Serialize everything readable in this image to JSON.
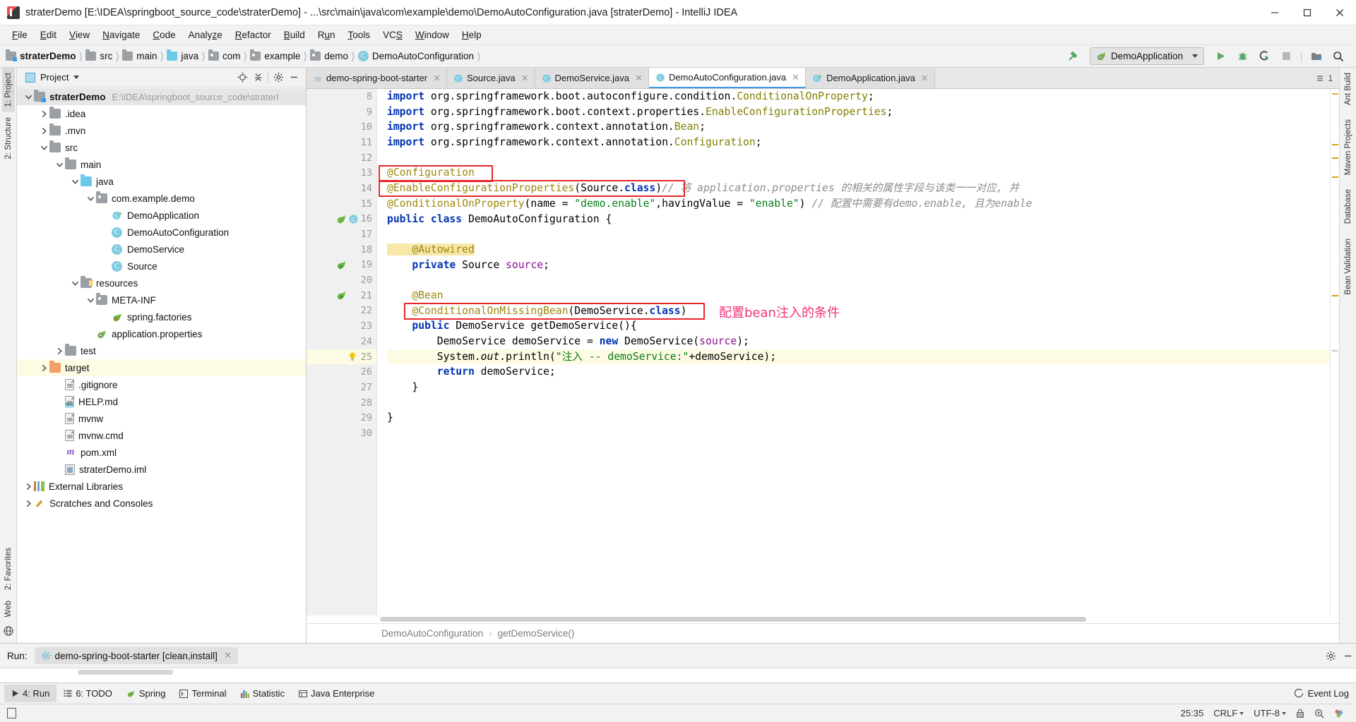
{
  "window": {
    "title": "straterDemo [E:\\IDEA\\springboot_source_code\\straterDemo] - ...\\src\\main\\java\\com\\example\\demo\\DemoAutoConfiguration.java [straterDemo] - IntelliJ IDEA",
    "minimize": "─",
    "maximize": "❐",
    "close": "✕"
  },
  "menu": [
    "File",
    "Edit",
    "View",
    "Navigate",
    "Code",
    "Analyze",
    "Refactor",
    "Build",
    "Run",
    "Tools",
    "VCS",
    "Window",
    "Help"
  ],
  "breadcrumb": [
    {
      "label": "straterDemo",
      "icon": "project-folder-icon",
      "bold": true
    },
    {
      "label": "src",
      "icon": "folder-icon",
      "bold": false
    },
    {
      "label": "main",
      "icon": "folder-icon",
      "bold": false
    },
    {
      "label": "java",
      "icon": "source-folder-icon",
      "bold": false
    },
    {
      "label": "com",
      "icon": "package-icon",
      "bold": false
    },
    {
      "label": "example",
      "icon": "package-icon",
      "bold": false
    },
    {
      "label": "demo",
      "icon": "package-icon",
      "bold": false
    },
    {
      "label": "DemoAutoConfiguration",
      "icon": "class-icon",
      "bold": false
    }
  ],
  "toolbar": {
    "build_icon": "hammer-icon",
    "run_config": "DemoApplication",
    "run_icon": "run-icon",
    "debug_icon": "debug-icon",
    "coverage_icon": "run-with-coverage-icon",
    "stop_icon": "stop-icon",
    "project_structure_icon": "project-structure-icon",
    "search_icon": "search-icon"
  },
  "project_panel": {
    "title": "Project",
    "locate_icon": "locate-icon",
    "collapse_icon": "collapse-all-icon",
    "settings_icon": "gear-icon",
    "hide_icon": "hide-icon",
    "tree": [
      {
        "label": "straterDemo",
        "path": "E:\\IDEA\\springboot_source_code\\straterI",
        "indent": 0,
        "twist": "down",
        "icon": "project-folder-icon",
        "bold": true,
        "state": "sel"
      },
      {
        "label": ".idea",
        "indent": 1,
        "twist": "right",
        "icon": "folder-icon"
      },
      {
        "label": ".mvn",
        "indent": 1,
        "twist": "right",
        "icon": "folder-icon"
      },
      {
        "label": "src",
        "indent": 1,
        "twist": "down",
        "icon": "folder-icon"
      },
      {
        "label": "main",
        "indent": 2,
        "twist": "down",
        "icon": "folder-icon"
      },
      {
        "label": "java",
        "indent": 3,
        "twist": "down",
        "icon": "source-folder-icon"
      },
      {
        "label": "com.example.demo",
        "indent": 4,
        "twist": "down",
        "icon": "package-icon"
      },
      {
        "label": "DemoApplication",
        "indent": 5,
        "twist": "none",
        "icon": "spring-class-icon"
      },
      {
        "label": "DemoAutoConfiguration",
        "indent": 5,
        "twist": "none",
        "icon": "class-icon"
      },
      {
        "label": "DemoService",
        "indent": 5,
        "twist": "none",
        "icon": "class-icon"
      },
      {
        "label": "Source",
        "indent": 5,
        "twist": "none",
        "icon": "class-icon"
      },
      {
        "label": "resources",
        "indent": 3,
        "twist": "down",
        "icon": "resources-folder-icon"
      },
      {
        "label": "META-INF",
        "indent": 4,
        "twist": "down",
        "icon": "package-icon"
      },
      {
        "label": "spring.factories",
        "indent": 5,
        "twist": "none",
        "icon": "spring-factories-icon"
      },
      {
        "label": "application.properties",
        "indent": 4,
        "twist": "none",
        "icon": "spring-properties-icon"
      },
      {
        "label": "test",
        "indent": 2,
        "twist": "right",
        "icon": "folder-icon"
      },
      {
        "label": "target",
        "indent": 1,
        "twist": "right",
        "icon": "target-folder-icon",
        "state": "hl"
      },
      {
        "label": ".gitignore",
        "indent": 2,
        "twist": "none",
        "icon": "file-icon"
      },
      {
        "label": "HELP.md",
        "indent": 2,
        "twist": "none",
        "icon": "markdown-icon"
      },
      {
        "label": "mvnw",
        "indent": 2,
        "twist": "none",
        "icon": "file-icon"
      },
      {
        "label": "mvnw.cmd",
        "indent": 2,
        "twist": "none",
        "icon": "file-icon"
      },
      {
        "label": "pom.xml",
        "indent": 2,
        "twist": "none",
        "icon": "maven-icon"
      },
      {
        "label": "straterDemo.iml",
        "indent": 2,
        "twist": "none",
        "icon": "iml-icon"
      },
      {
        "label": "External Libraries",
        "indent": 0,
        "twist": "right",
        "icon": "libraries-icon"
      },
      {
        "label": "Scratches and Consoles",
        "indent": 0,
        "twist": "right",
        "icon": "scratches-icon"
      }
    ]
  },
  "left_strip": [
    "1: Project",
    "2: Structure",
    "2: Favorites",
    "Web"
  ],
  "right_strip": [
    "Ant Build",
    "Maven Projects",
    "Database",
    "Bean Validation"
  ],
  "editor_tabs": [
    {
      "label": "demo-spring-boot-starter",
      "icon": "maven-module-icon",
      "active": false
    },
    {
      "label": "Source.java",
      "icon": "class-icon",
      "active": false
    },
    {
      "label": "DemoService.java",
      "icon": "class-icon",
      "active": false
    },
    {
      "label": "DemoAutoConfiguration.java",
      "icon": "class-icon",
      "active": true
    },
    {
      "label": "DemoApplication.java",
      "icon": "spring-class-icon",
      "active": false
    }
  ],
  "editor_tabs_overflow": "1",
  "code": {
    "first_line": 8,
    "lines": [
      {
        "n": 8,
        "tokens": [
          {
            "t": "import ",
            "c": "kw"
          },
          {
            "t": "org.springframework.boot.autoconfigure.condition.",
            "c": "id"
          },
          {
            "t": "ConditionalOnProperty",
            "c": "ann2"
          },
          {
            "t": ";",
            "c": "id"
          }
        ]
      },
      {
        "n": 9,
        "tokens": [
          {
            "t": "import ",
            "c": "kw"
          },
          {
            "t": "org.springframework.boot.context.properties.",
            "c": "id"
          },
          {
            "t": "EnableConfigurationProperties",
            "c": "ann2"
          },
          {
            "t": ";",
            "c": "id"
          }
        ]
      },
      {
        "n": 10,
        "tokens": [
          {
            "t": "import ",
            "c": "kw"
          },
          {
            "t": "org.springframework.context.annotation.",
            "c": "id"
          },
          {
            "t": "Bean",
            "c": "ann2"
          },
          {
            "t": ";",
            "c": "id"
          }
        ]
      },
      {
        "n": 11,
        "tokens": [
          {
            "t": "import ",
            "c": "kw"
          },
          {
            "t": "org.springframework.context.annotation.",
            "c": "id"
          },
          {
            "t": "Configuration",
            "c": "ann2"
          },
          {
            "t": ";",
            "c": "id"
          }
        ]
      },
      {
        "n": 12,
        "tokens": []
      },
      {
        "n": 13,
        "tokens": [
          {
            "t": "@Configuration",
            "c": "ann"
          }
        ]
      },
      {
        "n": 14,
        "tokens": [
          {
            "t": "@EnableConfigurationProperties",
            "c": "ann"
          },
          {
            "t": "(",
            "c": "id"
          },
          {
            "t": "Source",
            "c": "id"
          },
          {
            "t": ".",
            "c": "id"
          },
          {
            "t": "class",
            "c": "kw"
          },
          {
            "t": ")",
            "c": "id"
          },
          {
            "t": "// 将 application.properties 的相关的属性字段与该类一一对应, 并",
            "c": "cmt"
          }
        ]
      },
      {
        "n": 15,
        "tokens": [
          {
            "t": "@ConditionalOnProperty",
            "c": "ann"
          },
          {
            "t": "(name = ",
            "c": "id"
          },
          {
            "t": "\"demo.enable\"",
            "c": "str"
          },
          {
            "t": ",havingValue = ",
            "c": "id"
          },
          {
            "t": "\"enable\"",
            "c": "str"
          },
          {
            "t": ") ",
            "c": "id"
          },
          {
            "t": "// 配置中需要有demo.enable, 且为enable",
            "c": "cmt"
          }
        ]
      },
      {
        "n": 16,
        "tokens": [
          {
            "t": "public class ",
            "c": "kw"
          },
          {
            "t": "DemoAutoConfiguration",
            "c": "id"
          },
          {
            "t": " {",
            "c": "id"
          }
        ]
      },
      {
        "n": 17,
        "tokens": []
      },
      {
        "n": 18,
        "tokens": [
          {
            "t": "    @Autowired",
            "c": "ann"
          }
        ]
      },
      {
        "n": 19,
        "tokens": [
          {
            "t": "    ",
            "c": "id"
          },
          {
            "t": "private ",
            "c": "kw"
          },
          {
            "t": "Source ",
            "c": "id"
          },
          {
            "t": "source",
            "c": "fld"
          },
          {
            "t": ";",
            "c": "id"
          }
        ]
      },
      {
        "n": 20,
        "tokens": []
      },
      {
        "n": 21,
        "tokens": [
          {
            "t": "    @Bean",
            "c": "ann"
          }
        ]
      },
      {
        "n": 22,
        "tokens": [
          {
            "t": "    @ConditionalOnMissingBean",
            "c": "ann"
          },
          {
            "t": "(",
            "c": "id"
          },
          {
            "t": "DemoService",
            "c": "id"
          },
          {
            "t": ".",
            "c": "id"
          },
          {
            "t": "class",
            "c": "kw"
          },
          {
            "t": ")",
            "c": "id"
          }
        ]
      },
      {
        "n": 23,
        "tokens": [
          {
            "t": "    ",
            "c": "id"
          },
          {
            "t": "public ",
            "c": "kw"
          },
          {
            "t": "DemoService getDemoService(){",
            "c": "id"
          }
        ]
      },
      {
        "n": 24,
        "tokens": [
          {
            "t": "        DemoService demoService = ",
            "c": "id"
          },
          {
            "t": "new ",
            "c": "kw"
          },
          {
            "t": "DemoService(",
            "c": "id"
          },
          {
            "t": "source",
            "c": "fld"
          },
          {
            "t": ");",
            "c": "id"
          }
        ]
      },
      {
        "n": 25,
        "tokens": [
          {
            "t": "        System.",
            "c": "id"
          },
          {
            "t": "out",
            "c": "stat"
          },
          {
            "t": ".println(",
            "c": "id"
          },
          {
            "t": "\"注入 -- demoService:\"",
            "c": "str"
          },
          {
            "t": "+demoService);",
            "c": "id"
          }
        ],
        "highlight": true
      },
      {
        "n": 26,
        "tokens": [
          {
            "t": "        ",
            "c": "id"
          },
          {
            "t": "return ",
            "c": "kw"
          },
          {
            "t": "demoService;",
            "c": "id"
          }
        ]
      },
      {
        "n": 27,
        "tokens": [
          {
            "t": "    }",
            "c": "id"
          }
        ]
      },
      {
        "n": 28,
        "tokens": []
      },
      {
        "n": 29,
        "tokens": [
          {
            "t": "}",
            "c": "id"
          }
        ]
      },
      {
        "n": 30,
        "tokens": []
      }
    ],
    "annotation_note": "配置bean注入的条件",
    "note_color": "#f0327a",
    "redbox_color": "#e8262a"
  },
  "editor_breadcrumb": [
    "DemoAutoConfiguration",
    "getDemoService()"
  ],
  "run_panel": {
    "label": "Run:",
    "tab": "demo-spring-boot-starter [clean,install]",
    "tab_icon": "gear-spinner-icon",
    "close_icon": "✕",
    "settings_icon": "gear-icon",
    "hide_icon": "hide-icon"
  },
  "bottom_tabs": [
    {
      "label": "4: Run",
      "icon": "run-icon",
      "active": true
    },
    {
      "label": "6: TODO",
      "icon": "todo-icon",
      "active": false
    },
    {
      "label": "Spring",
      "icon": "spring-leaf-icon",
      "active": false
    },
    {
      "label": "Terminal",
      "icon": "terminal-icon",
      "active": false
    },
    {
      "label": "Statistic",
      "icon": "statistic-icon",
      "active": false
    },
    {
      "label": "Java Enterprise",
      "icon": "java-enterprise-icon",
      "active": false
    }
  ],
  "event_log": {
    "label": "Event Log",
    "icon": "event-log-icon"
  },
  "status": {
    "caret": "25:35",
    "line_sep": "CRLF",
    "encoding": "UTF-8",
    "lock_icon": "lock-icon",
    "inspect_icon": "inspection-icon",
    "scheme_icon": "scheme-icon"
  },
  "colors": {
    "accent": "#3d9be9",
    "spring_green": "#6db33f",
    "red_box": "#e8262a",
    "note_pink": "#f0327a",
    "highlight_yellow": "#fdfbe3"
  }
}
